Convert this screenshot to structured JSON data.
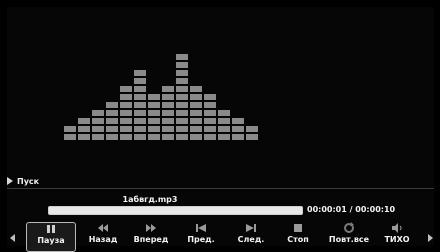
{
  "status": {
    "state_label": "Пуск"
  },
  "track": {
    "filename": "1абвгд.mp3",
    "time": "00:00:01 / 00:00:10",
    "progress_fraction": 1.0
  },
  "controls": [
    {
      "id": "pause",
      "label": "Пауза",
      "icon": "pause-icon",
      "selected": true
    },
    {
      "id": "rewind",
      "label": "Назад",
      "icon": "rewind-icon",
      "selected": false
    },
    {
      "id": "forward",
      "label": "Вперед",
      "icon": "fast-forward-icon",
      "selected": false
    },
    {
      "id": "prev",
      "label": "Пред.",
      "icon": "previous-track-icon",
      "selected": false
    },
    {
      "id": "next",
      "label": "След.",
      "icon": "next-track-icon",
      "selected": false
    },
    {
      "id": "stop",
      "label": "Стоп",
      "icon": "stop-icon",
      "selected": false
    },
    {
      "id": "repeat",
      "label": "Повт.все",
      "icon": "repeat-icon",
      "selected": false
    },
    {
      "id": "mute",
      "label": "ТИХО",
      "icon": "speaker-icon",
      "selected": false
    }
  ],
  "equalizer": {
    "column_levels": [
      2,
      3,
      4,
      5,
      7,
      9,
      6,
      7,
      11,
      7,
      6,
      4,
      3,
      2
    ]
  },
  "colors": {
    "background": "#000000",
    "block": "#8a8a8a",
    "progress_fill": "#e8e8e8"
  }
}
